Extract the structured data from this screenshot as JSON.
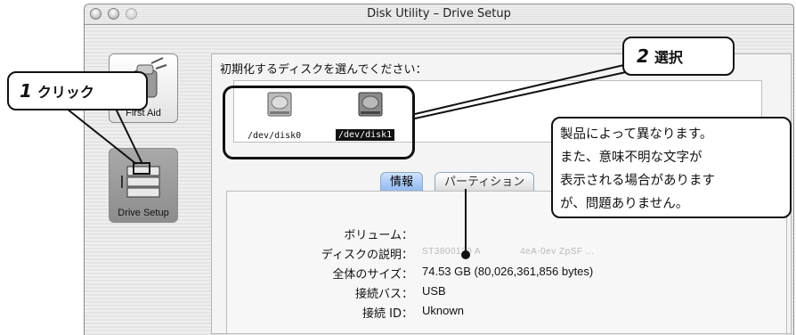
{
  "window": {
    "title": "Disk Utility – Drive Setup"
  },
  "toolbar": {
    "first_aid_label": "First Aid",
    "drive_setup_label": "Drive Setup"
  },
  "main": {
    "prompt": "初期化するディスクを選んでください：",
    "disks": [
      {
        "name": "/dev/disk0",
        "selected": false
      },
      {
        "name": "/dev/disk1",
        "selected": true
      }
    ],
    "tabs": [
      {
        "label": "情報",
        "active": true
      },
      {
        "label": "パーティション",
        "active": false
      }
    ],
    "info": [
      {
        "key": "ボリューム：",
        "value": ""
      },
      {
        "key": "ディスクの説明：",
        "value": "ST3800120 A",
        "value2": "4eA-0ev ZpSF ..."
      },
      {
        "key": "全体のサイズ：",
        "value": "74.53 GB (80,026,361,856 bytes)"
      },
      {
        "key": "接続バス：",
        "value": "USB"
      },
      {
        "key": "接続 ID：",
        "value": "Uknown"
      }
    ]
  },
  "annotations": {
    "step1": {
      "number": "1",
      "text": "クリック"
    },
    "step2": {
      "number": "2",
      "text": "選択"
    },
    "note_lines": [
      "製品によって異なります。",
      "また、意味不明な文字が",
      "表示される場合があります",
      "が、問題ありません。"
    ]
  }
}
